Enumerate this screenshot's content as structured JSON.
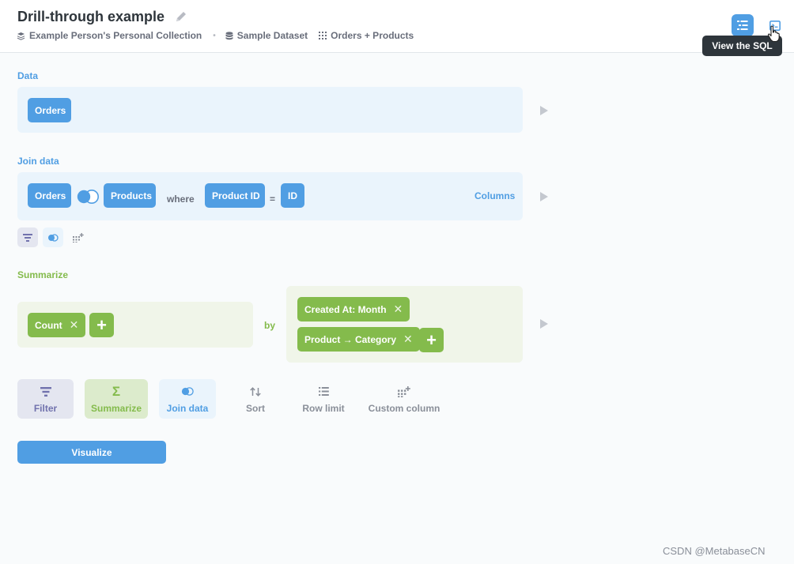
{
  "header": {
    "title": "Drill-through example",
    "breadcrumb": {
      "collection": "Example Person's Personal Collection",
      "separator": "•",
      "database": "Sample Dataset",
      "table": "Orders + Products"
    },
    "tooltip": "View the SQL"
  },
  "data_step": {
    "label": "Data",
    "table": "Orders"
  },
  "join_step": {
    "label": "Join data",
    "left_table": "Orders",
    "right_table": "Products",
    "where_label": "where",
    "left_column": "Product ID",
    "operator": "=",
    "right_column": "ID",
    "columns_link": "Columns"
  },
  "summarize_step": {
    "label": "Summarize",
    "metric": "Count",
    "by_label": "by",
    "breakouts": [
      "Created At: Month",
      "Product → Category"
    ]
  },
  "actions": {
    "filter": "Filter",
    "summarize": "Summarize",
    "join": "Join data",
    "sort": "Sort",
    "row_limit": "Row limit",
    "custom_column": "Custom column"
  },
  "visualize_label": "Visualize",
  "watermark": "CSDN @MetabaseCN",
  "colors": {
    "brand": "#509ee3",
    "summarize": "#84bb4c",
    "filter": "#7172ad",
    "text_dark": "#2e353b",
    "text_medium": "#696e7b"
  },
  "icons": [
    "pencil-icon",
    "collection-icon",
    "database-icon",
    "table-icon",
    "notebook-icon",
    "sql-icon",
    "filter-icon",
    "join-icon",
    "custom-column-icon",
    "sigma-icon",
    "sort-icon",
    "row-limit-icon",
    "play-arrow-icon",
    "pointer-cursor-icon"
  ]
}
